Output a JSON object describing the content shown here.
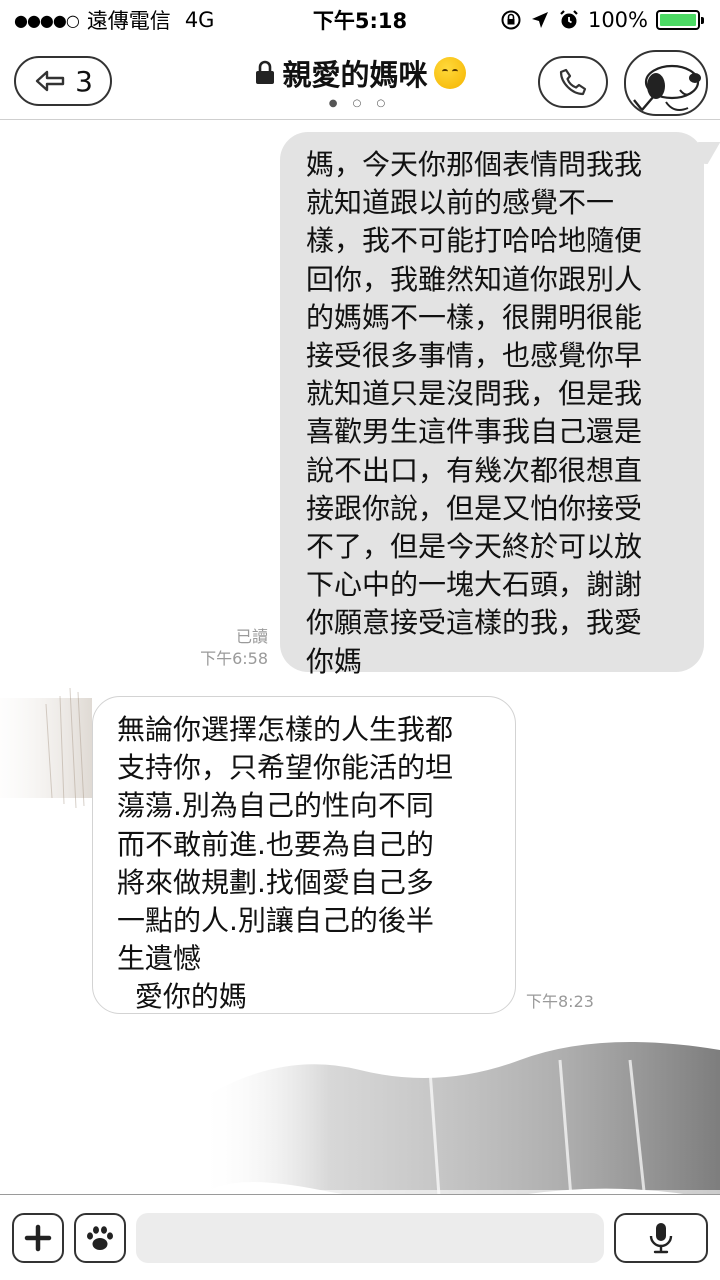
{
  "status_bar": {
    "signal": "●●●●○",
    "carrier": "遠傳電信",
    "network": "4G",
    "time": "下午5:18",
    "battery_percent": "100%",
    "battery_level": 1.0
  },
  "header": {
    "back_count": "3",
    "title": "親愛的媽咪",
    "page_indicator": "● ○ ○",
    "icons": [
      "back-arrow-icon",
      "lock-icon",
      "kissing-face-emoji",
      "phone-icon",
      "snoopy-avatar"
    ]
  },
  "messages": [
    {
      "direction": "outgoing",
      "text": "媽，今天你那個表情問我我\n就知道跟以前的感覺不一\n樣，我不可能打哈哈地隨便\n回你，我雖然知道你跟別人\n的媽媽不一樣，很開明很能\n接受很多事情，也感覺你早\n就知道只是沒問我，但是我\n喜歡男生這件事我自己還是\n說不出口，有幾次都很想直\n接跟你說，但是又怕你接受\n不了，但是今天終於可以放\n下心中的一塊大石頭，謝謝\n你願意接受這樣的我，我愛\n你媽",
      "read": "已讀",
      "time": "下午6:58"
    },
    {
      "direction": "incoming",
      "text": "無論你選擇怎樣的人生我都\n支持你，只希望你能活的坦\n蕩蕩.別為自己的性向不同\n而不敢前進.也要為自己的\n將來做規劃.找個愛自己多\n一點的人.別讓自己的後半\n生遺憾\n  愛你的媽",
      "time": "下午8:23"
    }
  ],
  "input_bar": {
    "placeholder": "",
    "icons": [
      "plus-icon",
      "paw-icon",
      "microphone-icon"
    ]
  },
  "colors": {
    "outgoing_bubble": "#e3e3e3",
    "incoming_bubble": "#ffffff",
    "battery": "#4cd964",
    "meta_text": "#9a9a9a"
  }
}
